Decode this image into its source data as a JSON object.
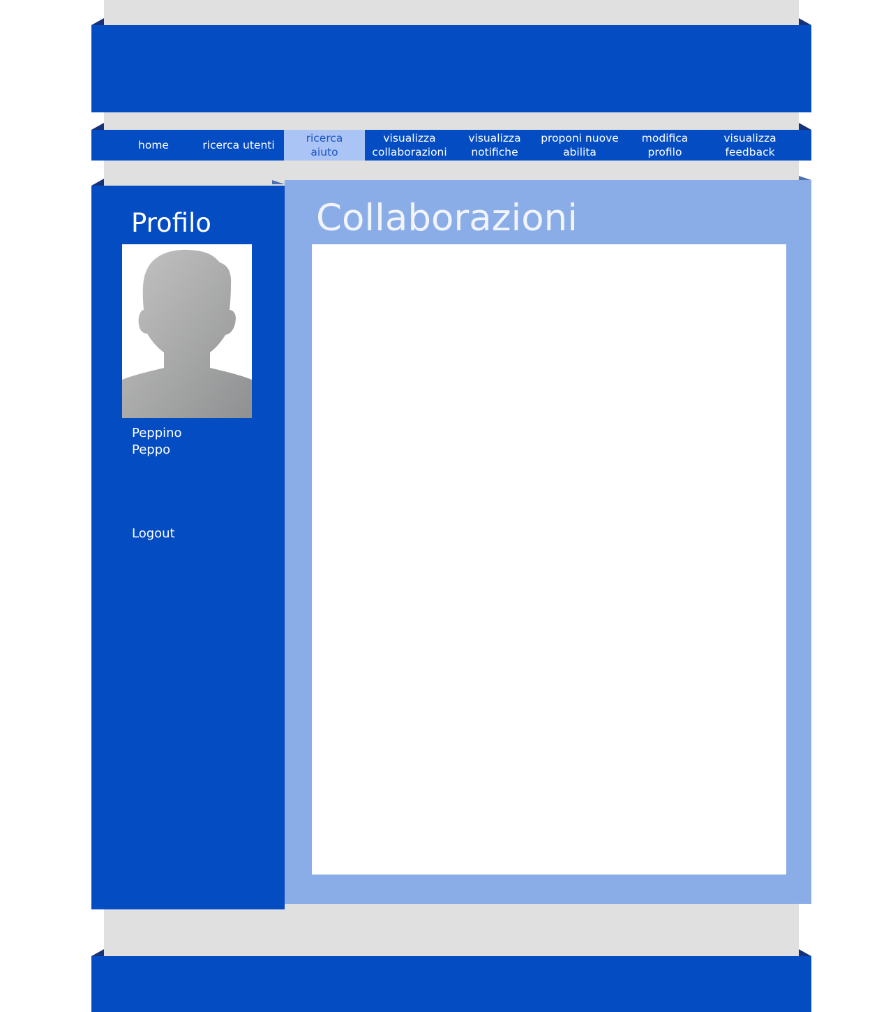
{
  "nav": {
    "items": [
      {
        "label": "home",
        "active": false
      },
      {
        "label": "ricerca utenti",
        "active": false
      },
      {
        "label": "ricerca\naiuto",
        "active": true
      },
      {
        "label": "visualizza\ncollaborazioni",
        "active": false
      },
      {
        "label": "visualizza\nnotifiche",
        "active": false
      },
      {
        "label": "proponi nuove\nabilita",
        "active": false
      },
      {
        "label": "modifica\nprofilo",
        "active": false
      },
      {
        "label": "visualizza\nfeedback",
        "active": false
      }
    ]
  },
  "sidebar": {
    "title": "Profilo",
    "user_name": "Peppino\nPeppo",
    "logout_label": "Logout"
  },
  "main": {
    "title": "Collaborazioni"
  },
  "colors": {
    "primary_blue": "#034cc2",
    "panel_light_blue": "#8aace7",
    "nav_active_bg": "#a9c4f5",
    "page_gray": "#e0e0e0"
  },
  "icons": {
    "avatar": "default-user-silhouette"
  }
}
